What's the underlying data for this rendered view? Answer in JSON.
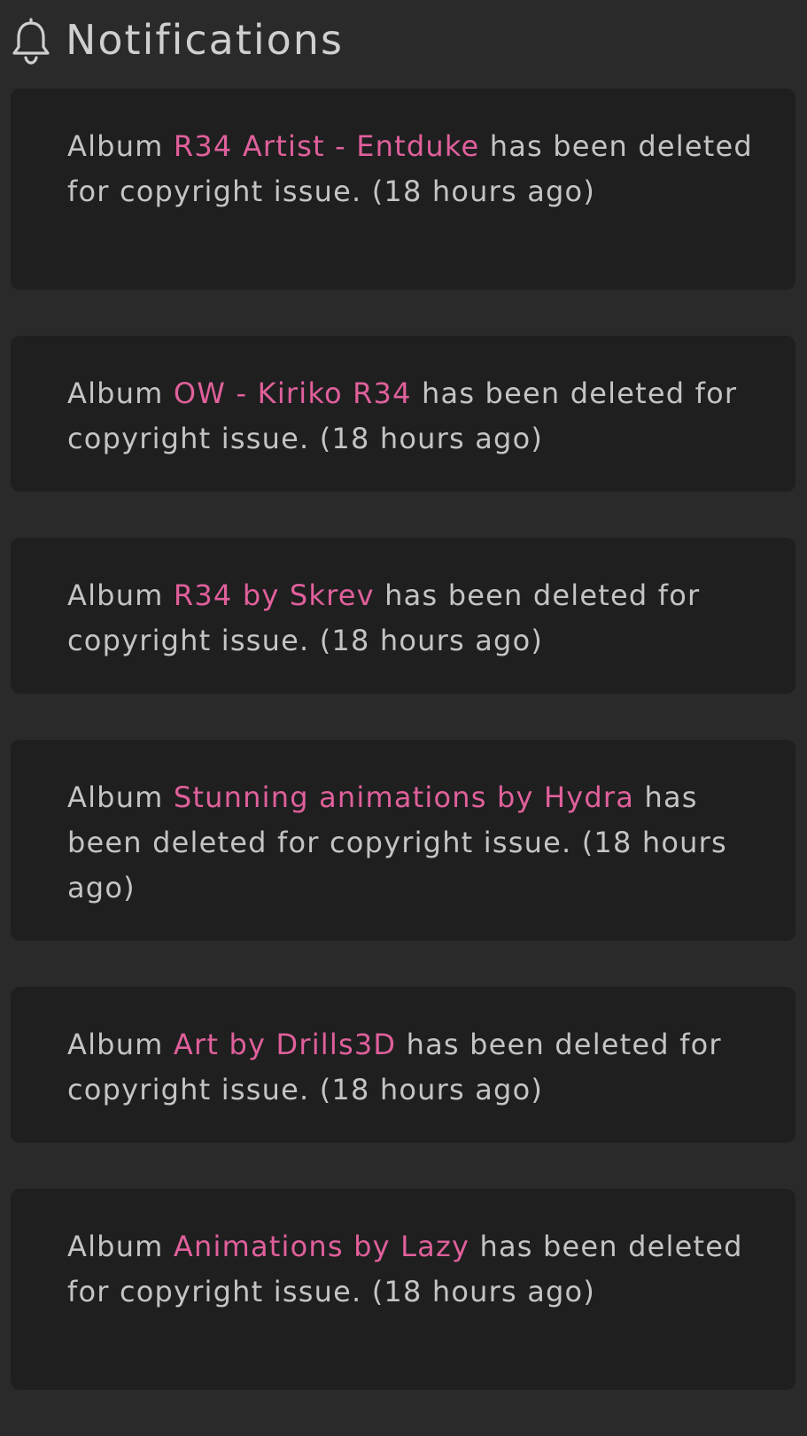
{
  "header": {
    "icon": "bell-icon",
    "title": "Notifications"
  },
  "colors": {
    "background": "#2a2a2b",
    "card": "#1f1f20",
    "text": "#c4c4c4",
    "accent": "#e0609b"
  },
  "notifications": [
    {
      "prefix": "Album ",
      "album": "R34 Artist - Entduke",
      "suffix": " has been deleted for copyright issue. (18 hours ago)"
    },
    {
      "prefix": "Album ",
      "album": "OW - Kiriko R34",
      "suffix": " has been deleted for copyright issue. (18 hours ago)"
    },
    {
      "prefix": "Album ",
      "album": "R34 by Skrev",
      "suffix": " has been deleted for copyright issue. (18 hours ago)"
    },
    {
      "prefix": "Album ",
      "album": "Stunning animations by Hydra",
      "suffix": " has been deleted for copyright issue. (18 hours ago)"
    },
    {
      "prefix": "Album ",
      "album": "Art by Drills3D",
      "suffix": " has been deleted for copyright issue. (18 hours ago)"
    },
    {
      "prefix": "Album ",
      "album": "Animations by Lazy",
      "suffix": " has been deleted for copyright issue. (18 hours ago)"
    }
  ]
}
